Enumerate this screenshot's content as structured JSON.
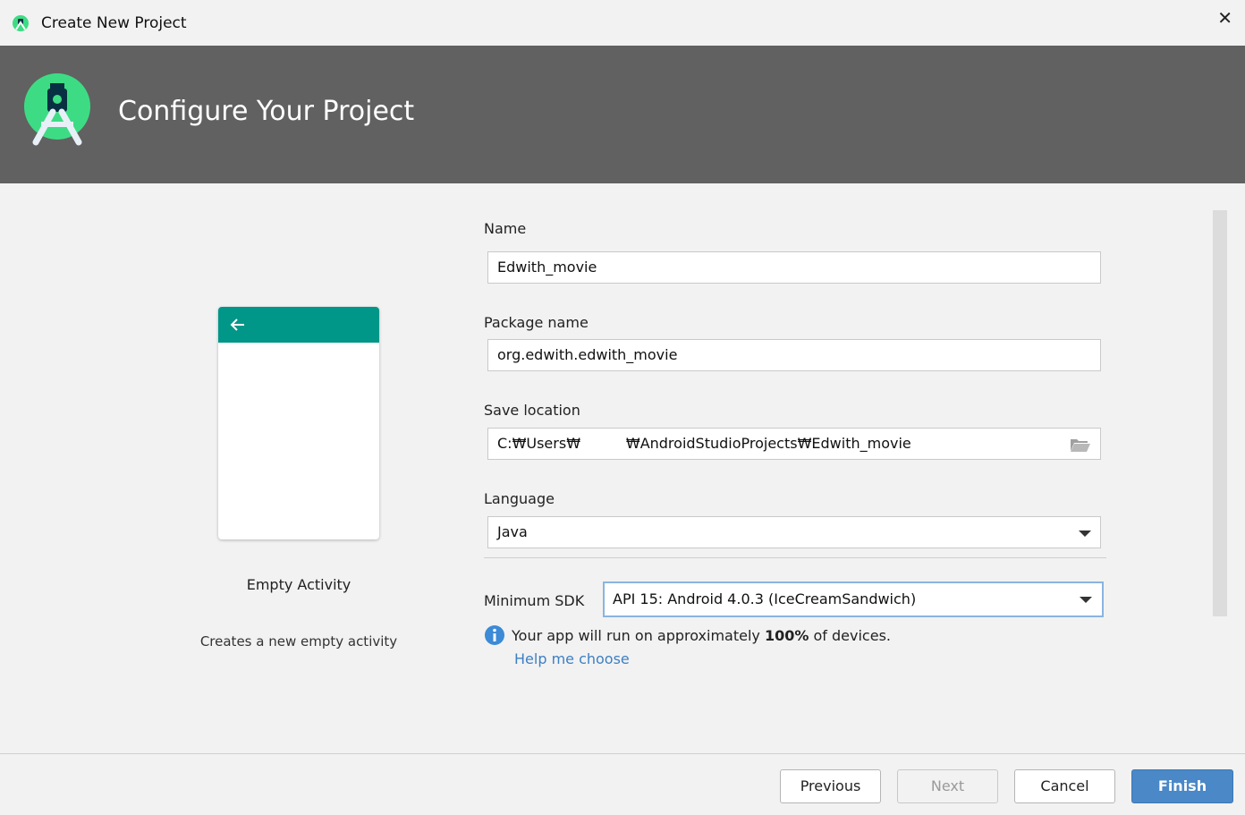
{
  "window": {
    "title": "Create New Project",
    "close_symbol": "✕"
  },
  "banner": {
    "heading": "Configure Your Project"
  },
  "template": {
    "name": "Empty Activity",
    "description": "Creates a new empty activity",
    "appbar_color": "#009688"
  },
  "form": {
    "name": {
      "label": "Name",
      "value": "Edwith_movie"
    },
    "package": {
      "label": "Package name",
      "value": "org.edwith.edwith_movie"
    },
    "save_location": {
      "label": "Save location",
      "value": "C:₩Users₩          ₩AndroidStudioProjects₩Edwith_movie"
    },
    "language": {
      "label": "Language",
      "value": "Java"
    },
    "min_sdk": {
      "label": "Minimum SDK",
      "value": "API 15: Android 4.0.3 (IceCreamSandwich)"
    }
  },
  "info": {
    "prefix": "Your app will run on approximately ",
    "percent": "100%",
    "suffix": " of devices.",
    "help_link": "Help me choose"
  },
  "buttons": {
    "previous": "Previous",
    "next": "Next",
    "cancel": "Cancel",
    "finish": "Finish"
  },
  "colors": {
    "banner_bg": "#616161",
    "accent": "#4a88c7",
    "android_green": "#3ddc84",
    "link": "#3d7fc4"
  }
}
